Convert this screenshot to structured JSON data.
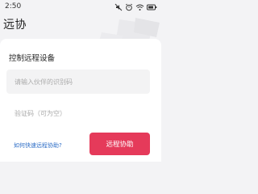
{
  "status_bar": {
    "time": "2:50",
    "icons": [
      "mute-icon",
      "alarm-icon",
      "wifi-icon",
      "battery-icon"
    ]
  },
  "app": {
    "title": "远协"
  },
  "form": {
    "title": "控制远程设备",
    "partner_id_placeholder": "请输入伙伴的识别码",
    "verification_placeholder": "验证码（可为空）",
    "help_link": "如何快速远程协助?",
    "submit_label": "远程协助"
  },
  "colors": {
    "accent": "#e53a5a",
    "link": "#2f6fc7",
    "background": "#f3f3f5",
    "card": "#ffffff"
  }
}
